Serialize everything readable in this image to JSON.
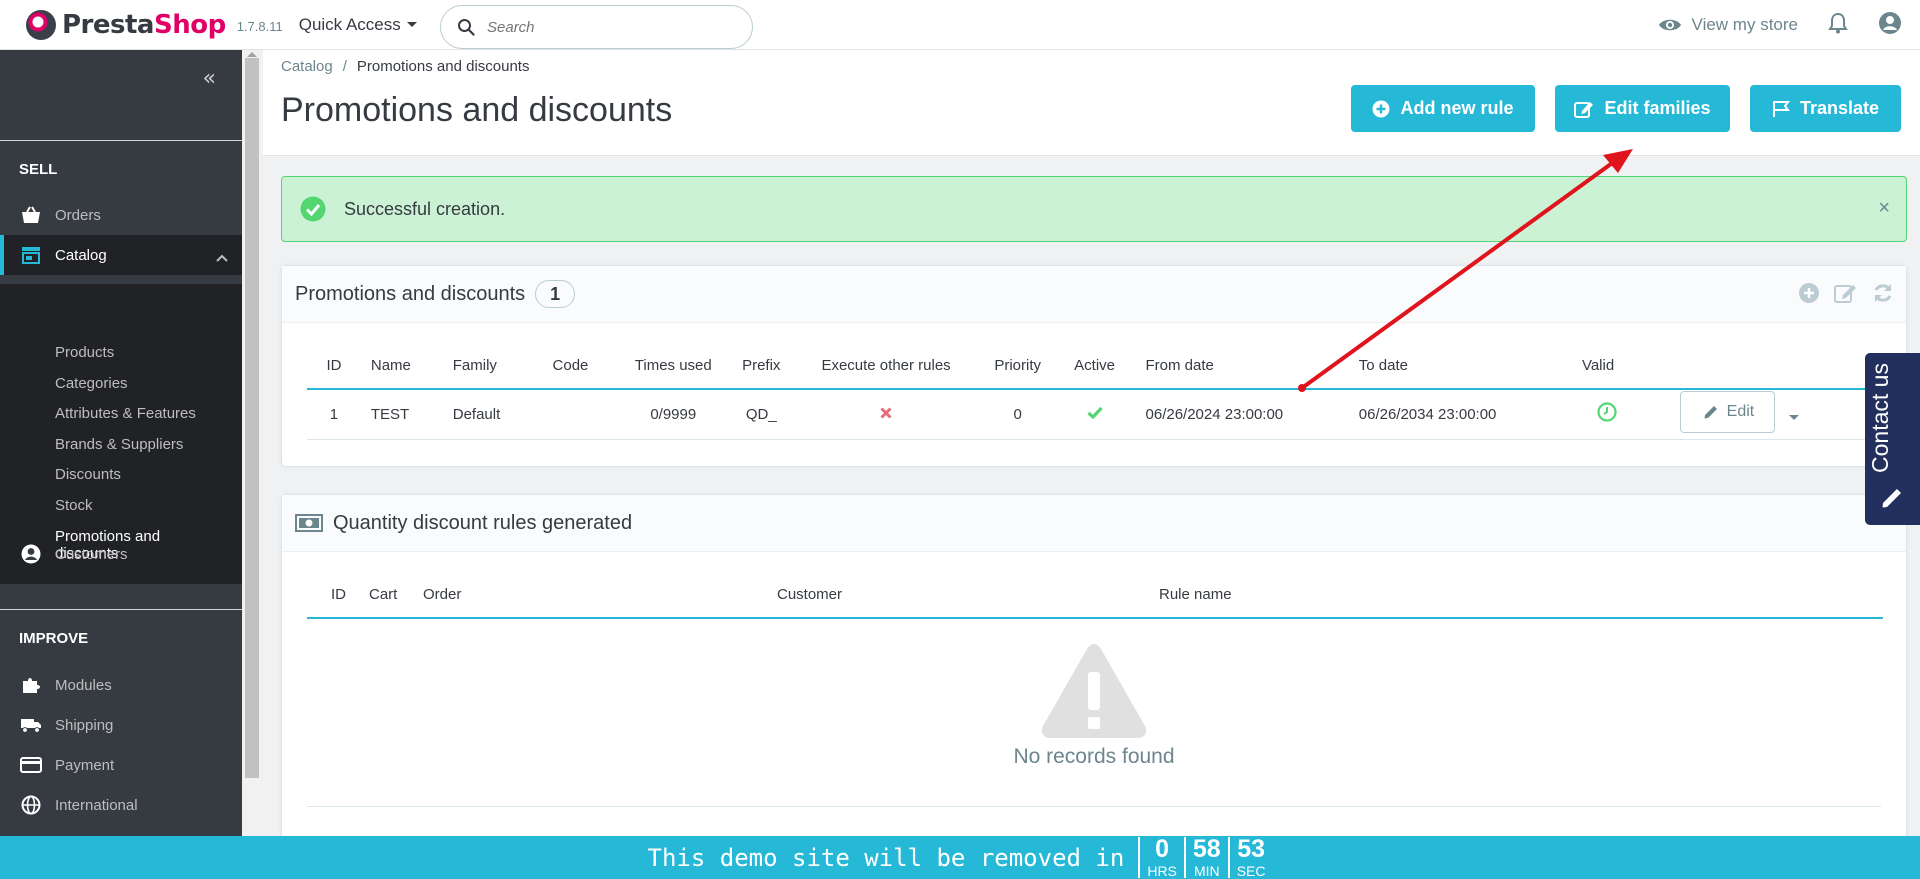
{
  "header": {
    "logo_prefix": "Presta",
    "logo_suffix": "Shop",
    "version": "1.7.8.11",
    "quick_access": "Quick Access",
    "search_placeholder": "Search",
    "view_store": "View my store"
  },
  "sidebar": {
    "sell_title": "SELL",
    "improve_title": "IMPROVE",
    "items": {
      "orders": "Orders",
      "catalog": "Catalog",
      "customers": "Customers",
      "modules": "Modules",
      "shipping": "Shipping",
      "payment": "Payment",
      "international": "International"
    },
    "catalog_sub": [
      "Products",
      "Categories",
      "Attributes & Features",
      "Brands & Suppliers",
      "Discounts",
      "Stock",
      "Promotions and discounts"
    ]
  },
  "page": {
    "breadcrumb_parent": "Catalog",
    "breadcrumb_current": "Promotions and discounts",
    "title": "Promotions and discounts",
    "buttons": {
      "add_rule": "Add new rule",
      "edit_families": "Edit families",
      "translate": "Translate"
    }
  },
  "alert": {
    "message": "Successful creation.",
    "close": "×"
  },
  "rules_panel": {
    "title": "Promotions and discounts",
    "count": "1",
    "columns": [
      "ID",
      "Name",
      "Family",
      "Code",
      "Times used",
      "Prefix",
      "Execute other rules",
      "Priority",
      "Active",
      "From date",
      "To date",
      "Valid"
    ],
    "rows": [
      {
        "id": "1",
        "name": "TEST",
        "family": "Default",
        "code": "",
        "times_used": "0/9999",
        "prefix": "QD_",
        "priority": "0",
        "from_date": "06/26/2024 23:00:00",
        "to_date": "06/26/2034 23:00:00",
        "edit_label": "Edit"
      }
    ]
  },
  "generated_panel": {
    "title": "Quantity discount rules generated",
    "columns": [
      "ID",
      "Cart",
      "Order",
      "Customer",
      "Rule name"
    ],
    "empty_text": "No records found"
  },
  "contact_tab": {
    "label": "Contact us"
  },
  "demo_bar": {
    "text": "This demo site will be removed in",
    "hours": "0",
    "hours_label": "HRS",
    "minutes": "58",
    "minutes_label": "MIN",
    "seconds": "53",
    "seconds_label": "SEC"
  },
  "colors": {
    "accent": "#25b9d7",
    "brand": "#df0067",
    "success": "#53d572",
    "sidebar": "#363a41",
    "arrow": "#e0141c"
  }
}
